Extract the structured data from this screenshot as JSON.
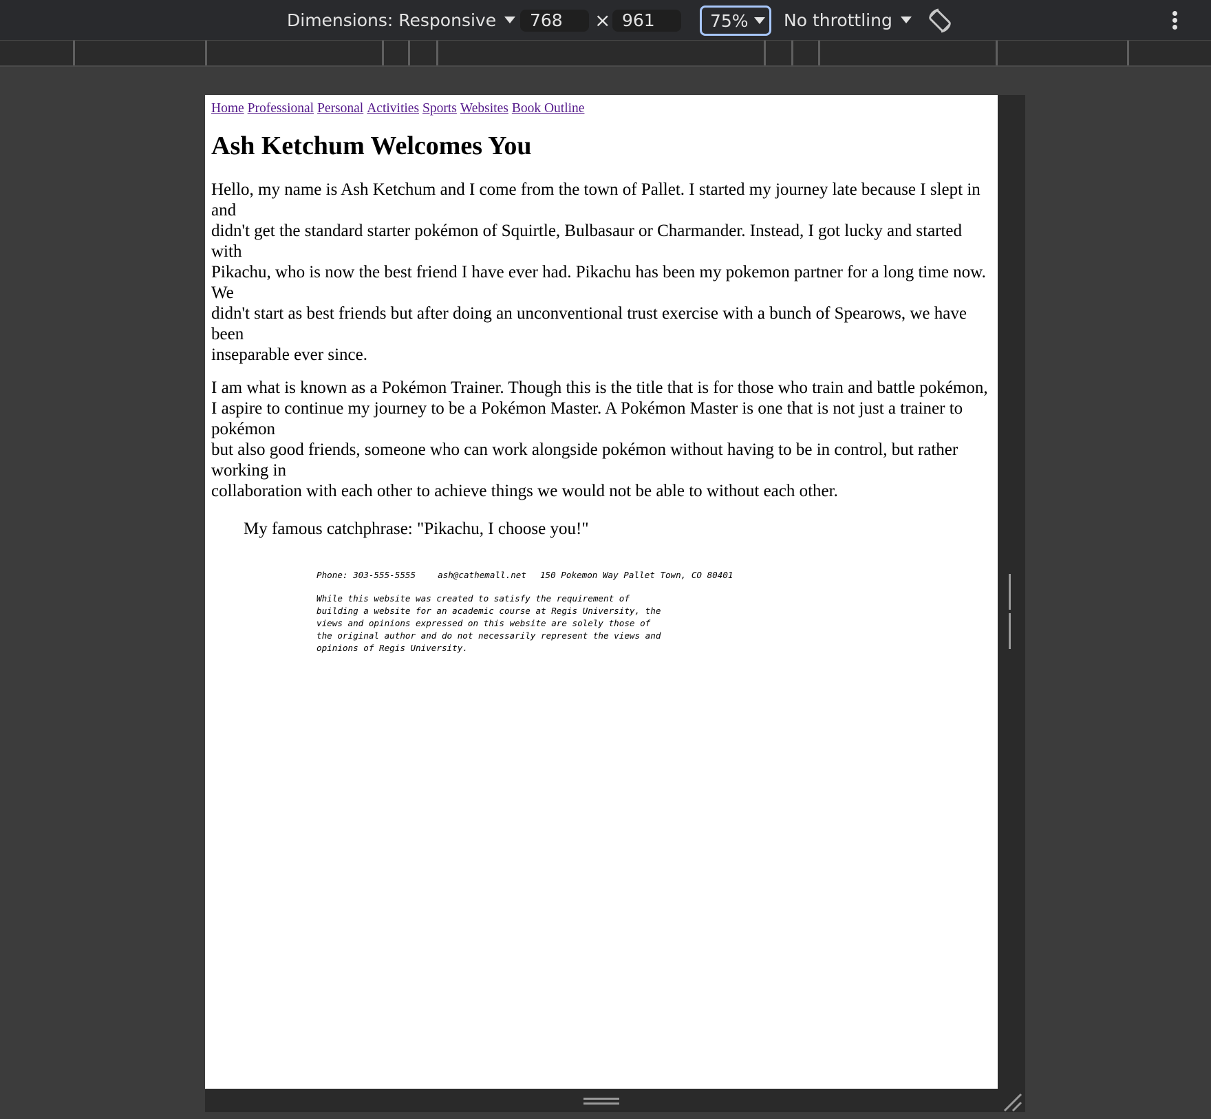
{
  "devtools": {
    "dimensions_label": "Dimensions: Responsive",
    "width_value": "768",
    "times_sign": "×",
    "height_value": "961",
    "zoom_value": "75%",
    "throttling_label": "No throttling"
  },
  "site": {
    "nav": [
      "Home",
      "Professional",
      "Personal",
      "Activities",
      "Sports",
      "Websites",
      "Book Outline"
    ],
    "heading": "Ash Ketchum Welcomes You",
    "para1": [
      "Hello, my name is Ash Ketchum and I come from the town of Pallet. I started my journey late because I slept in and",
      "didn't get the standard starter pokémon of Squirtle, Bulbasaur or Charmander. Instead, I got lucky and started with",
      "Pikachu, who is now the best friend I have ever had. Pikachu has been my pokemon partner for a long time now. We",
      "didn't start as best friends but after doing an unconventional trust exercise with a bunch of Spearows, we have been",
      "inseparable ever since."
    ],
    "para2": [
      "I am what is known as a Pokémon Trainer. Though this is the title that is for those who train and battle pokémon,",
      "I aspire to continue my journey to be a Pokémon Master. A Pokémon Master is one that is not just a trainer to pokémon",
      "but also good friends, someone who can work alongside pokémon without having to be in control, but rather working in",
      "collaboration with each other to achieve things we would not be able to without each other."
    ],
    "catchphrase": "My famous catchphrase: \"Pikachu, I choose you!\"",
    "footer": {
      "phone": "Phone: 303-555-5555",
      "email": "ash@cathemall.net",
      "address": "150 Pokemon Way Pallet Town, CO 80401",
      "disclaimer": [
        "While this website was created to satisfy the requirement of",
        "building a website for an academic course at Regis University, the",
        "views and opinions expressed on this website are solely those of",
        "the original author and do not necessarily represent the views and",
        "opinions of Regis University."
      ]
    }
  }
}
